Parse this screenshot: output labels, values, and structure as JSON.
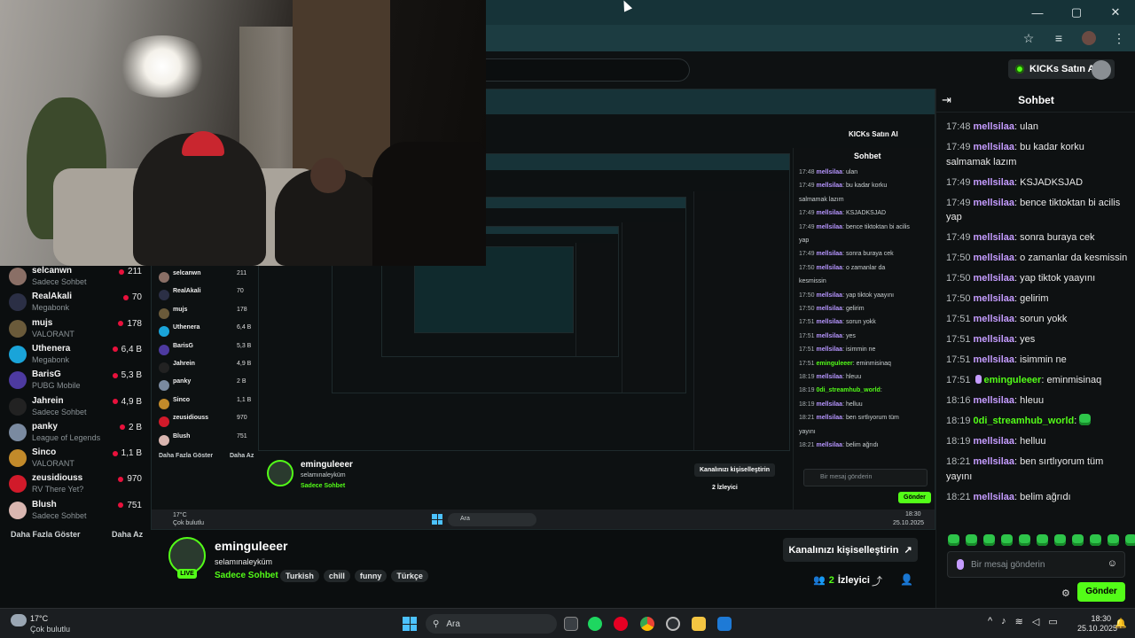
{
  "browser": {
    "window_buttons": [
      "—",
      "▢",
      "✕"
    ],
    "icons": [
      "star-icon",
      "media-control-icon",
      "profile-icon",
      "kebab-menu-icon"
    ]
  },
  "header": {
    "search_partial": "ra",
    "kicks_button": "KICKs Satın Al"
  },
  "sidebar": {
    "channels": [
      {
        "name": "selcanwn",
        "category": "Sadece Sohbet",
        "viewers": "211",
        "color": "#8a6f66"
      },
      {
        "name": "RealAkali",
        "category": "Megabonk",
        "viewers": "70",
        "color": "#2b2f45"
      },
      {
        "name": "mujs",
        "category": "VALORANT",
        "viewers": "178",
        "color": "#6a5a3a"
      },
      {
        "name": "Uthenera",
        "category": "Megabonk",
        "viewers": "6,4 B",
        "color": "#1aa4d9"
      },
      {
        "name": "BarisG",
        "category": "PUBG Mobile",
        "viewers": "5,3 B",
        "color": "#4d3aa0"
      },
      {
        "name": "Jahrein",
        "category": "Sadece Sohbet",
        "viewers": "4,9 B",
        "color": "#222"
      },
      {
        "name": "panky",
        "category": "League of Legends",
        "viewers": "2 B",
        "color": "#7a8aa0"
      },
      {
        "name": "Sinco",
        "category": "VALORANT",
        "viewers": "1,1 B",
        "color": "#c28a2a"
      },
      {
        "name": "zeusidiouss",
        "category": "RV There Yet?",
        "viewers": "970",
        "color": "#d11a2a"
      },
      {
        "name": "Blush",
        "category": "Sadece Sohbet",
        "viewers": "751",
        "color": "#d9b6b0"
      }
    ],
    "show_more": "Daha Fazla Göster",
    "show_less": "Daha Az"
  },
  "stream": {
    "live_badge": "LIVE",
    "streamer": "eminguleeer",
    "title": "selamınaleyküm",
    "category": "Sadece Sohbet",
    "tags": [
      "Turkish",
      "chill",
      "funny",
      "Türkçe"
    ],
    "customize_button": "Kanalınızı kişiselleştirin",
    "viewer_count": "2",
    "viewer_label": "İzleyici"
  },
  "chat": {
    "title": "Sohbet",
    "messages": [
      {
        "time": "17:48",
        "user": "mellsilaa",
        "text": "ulan"
      },
      {
        "time": "17:49",
        "user": "mellsilaa",
        "text": "bu kadar korku salmamak lazım"
      },
      {
        "time": "17:49",
        "user": "mellsilaa",
        "text": "KSJADKSJAD"
      },
      {
        "time": "17:49",
        "user": "mellsilaa",
        "text": "bence tiktoktan bi acilis yap"
      },
      {
        "time": "17:49",
        "user": "mellsilaa",
        "text": "sonra buraya cek"
      },
      {
        "time": "17:50",
        "user": "mellsilaa",
        "text": "o zamanlar da kesmissin"
      },
      {
        "time": "17:50",
        "user": "mellsilaa",
        "text": "yap tiktok yaayını"
      },
      {
        "time": "17:50",
        "user": "mellsilaa",
        "text": "gelirim"
      },
      {
        "time": "17:51",
        "user": "mellsilaa",
        "text": "sorun yokk"
      },
      {
        "time": "17:51",
        "user": "mellsilaa",
        "text": "yes"
      },
      {
        "time": "17:51",
        "user": "mellsilaa",
        "text": "isimmin ne"
      },
      {
        "time": "17:51",
        "user": "eminguleeer",
        "text": "eminmisinaq",
        "green": true,
        "mic": true
      },
      {
        "time": "18:16",
        "user": "mellsilaa",
        "text": "hleuu"
      },
      {
        "time": "18:19",
        "user": "0di_streamhub_world",
        "text": "",
        "green": true,
        "emote": true
      },
      {
        "time": "18:19",
        "user": "mellsilaa",
        "text": "helluu"
      },
      {
        "time": "18:21",
        "user": "mellsilaa",
        "text": "ben sırtlıyorum tüm yayını"
      },
      {
        "time": "18:21",
        "user": "mellsilaa",
        "text": "belim ağrıdı"
      }
    ],
    "input_placeholder": "Bir mesaj gönderin",
    "send_button": "Gönder"
  },
  "taskbar": {
    "temp": "17°C",
    "weather": "Çok bulutlu",
    "search": "Ara",
    "time": "18:30",
    "date": "25.10.2025"
  },
  "mirror": {
    "chat_title": "Sohbet",
    "kicks_button": "KICKs Satın Al",
    "streamer": "eminguleeer",
    "title": "selamınaleyküm",
    "category": "Sadece Sohbet",
    "customize_button": "Kanalınızı kişiselleştirin",
    "viewers": "2 İzleyici",
    "input_placeholder": "Bir mesaj gönderin",
    "send_button": "Gönder",
    "show_more": "Daha Fazla Göster",
    "show_less": "Daha Az",
    "search": "Ara",
    "time": "18:30",
    "date": "25.10.2025",
    "temp": "17°C",
    "weather": "Çok bulutlu",
    "chat_lines": [
      {
        "time": "17:48",
        "user": "mellsilaa",
        "text": "ulan"
      },
      {
        "time": "17:49",
        "user": "mellsilaa",
        "text": "bu kadar korku"
      },
      {
        "time": "",
        "user": "",
        "text": "salmamak lazım"
      },
      {
        "time": "17:49",
        "user": "mellsilaa",
        "text": "KSJADKSJAD"
      },
      {
        "time": "17:49",
        "user": "mellsilaa",
        "text": "bence tiktoktan bi acilis"
      },
      {
        "time": "",
        "user": "",
        "text": "yap"
      },
      {
        "time": "17:49",
        "user": "mellsilaa",
        "text": "sonra buraya cek"
      },
      {
        "time": "17:50",
        "user": "mellsilaa",
        "text": "o zamanlar da"
      },
      {
        "time": "",
        "user": "",
        "text": "kesmissin"
      },
      {
        "time": "17:50",
        "user": "mellsilaa",
        "text": "yap tiktok yaayını"
      },
      {
        "time": "17:50",
        "user": "mellsilaa",
        "text": "gelirim"
      },
      {
        "time": "17:51",
        "user": "mellsilaa",
        "text": "sorun yokk"
      },
      {
        "time": "17:51",
        "user": "mellsilaa",
        "text": "yes"
      },
      {
        "time": "17:51",
        "user": "mellsilaa",
        "text": "isimmin ne"
      },
      {
        "time": "17:51",
        "user": "eminguleeer",
        "text": "eminmisinaq"
      },
      {
        "time": "18:19",
        "user": "mellsilaa",
        "text": "hleuu"
      },
      {
        "time": "18:19",
        "user": "0di_streamhub_world",
        "text": ""
      },
      {
        "time": "18:19",
        "user": "mellsilaa",
        "text": "helluu"
      },
      {
        "time": "18:21",
        "user": "mellsilaa",
        "text": "ben sırtlıyorum tüm"
      },
      {
        "time": "",
        "user": "",
        "text": "yayını"
      },
      {
        "time": "18:21",
        "user": "mellsilaa",
        "text": "belim ağrıdı"
      }
    ]
  },
  "colors": {
    "accent_green": "#53fc18",
    "username_purple": "#c59cff",
    "browser_teal": "#163338"
  }
}
